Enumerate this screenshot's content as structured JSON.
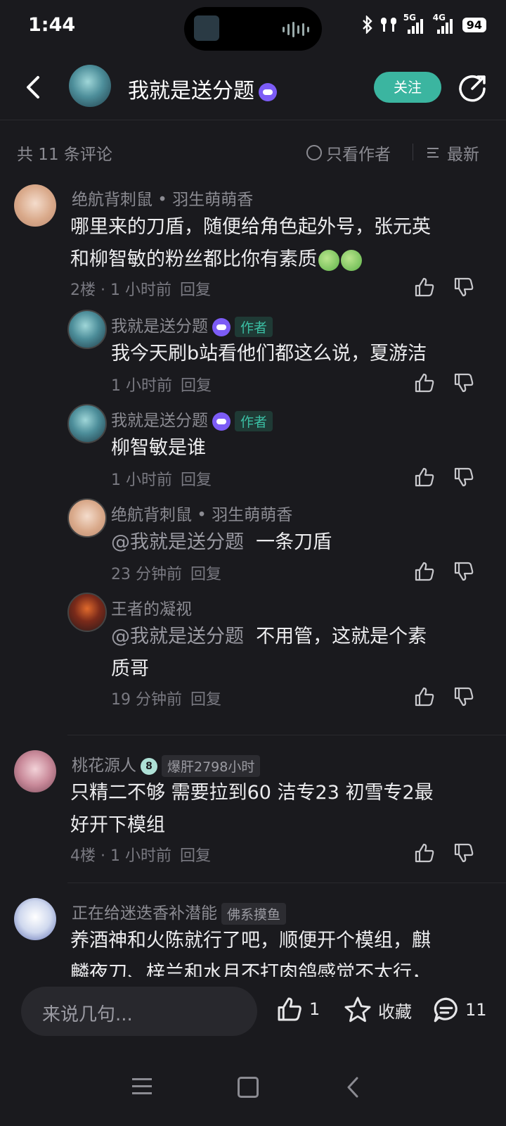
{
  "status": {
    "time": "1:44",
    "net1": "5G",
    "net2": "4G",
    "battery": "94"
  },
  "header": {
    "title": "我就是送分题",
    "follow_label": "关注"
  },
  "comments_header": {
    "count_text": "共 11 条评论",
    "only_author": "只看作者",
    "sort": "最新"
  },
  "comments": [
    {
      "name": "绝航背刺鼠 • 羽生萌萌香",
      "text_line1": "哪里来的刀盾，随便给角色起外号，张元英",
      "text_line2": "和柳智敏的粉丝都比你有素质",
      "floor_time": "2楼 · 1 小时前",
      "reply": "回复"
    },
    {
      "name": "我就是送分题",
      "tag": "作者",
      "text": "我今天刷b站看他们都这么说，夏游洁",
      "time": "1 小时前",
      "reply": "回复"
    },
    {
      "name": "我就是送分题",
      "tag": "作者",
      "text": "柳智敏是谁",
      "time": "1 小时前",
      "reply": "回复"
    },
    {
      "name": "绝航背刺鼠 • 羽生萌萌香",
      "mention": "@我就是送分题",
      "text": "一条刀盾",
      "time": "23 分钟前",
      "reply": "回复"
    },
    {
      "name": "王者的凝视",
      "mention": "@我就是送分题",
      "text_line1": "不用管，这就是个素",
      "text_line2": "质哥",
      "time": "19 分钟前",
      "reply": "回复"
    },
    {
      "name": "桃花源人",
      "level": "8",
      "tag": "爆肝2798小时",
      "text_line1": "只精二不够 需要拉到60 洁专23 初雪专2最",
      "text_line2": "好开下模组",
      "floor_time": "4楼 · 1 小时前",
      "reply": "回复"
    },
    {
      "name": "正在给迷迭香补潜能",
      "tag": "佛系摸鱼",
      "text_line1": "养酒神和火陈就行了吧，顺便开个模组，麒",
      "text_line2": "麟夜刀、梓兰和水月不打肉鸽感觉不太行，"
    }
  ],
  "bottom": {
    "placeholder": "来说几句...",
    "like_count": "1",
    "fav_label": "收藏",
    "comment_count": "11"
  }
}
